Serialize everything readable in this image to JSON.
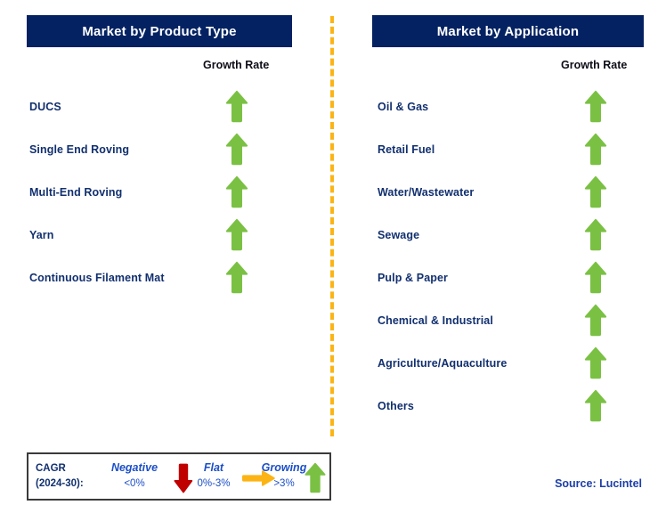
{
  "accent_colors": {
    "header_navy": "#042262",
    "label_navy": "#12306f",
    "arrow_green": "#7ac143",
    "arrow_red": "#c00000",
    "arrow_orange": "#fcb415",
    "divider_orange": "#fcb415",
    "legend_blue": "#1c4fc7",
    "source_blue": "#1c3fa8"
  },
  "left_panel": {
    "title": "Market by Product Type",
    "growth_rate_label": "Growth Rate",
    "rows": [
      {
        "label": "DUCS",
        "indicator": "up-arrow-icon",
        "growth": "Growing"
      },
      {
        "label": "Single End Roving",
        "indicator": "up-arrow-icon",
        "growth": "Growing"
      },
      {
        "label": "Multi-End Roving",
        "indicator": "up-arrow-icon",
        "growth": "Growing"
      },
      {
        "label": "Yarn",
        "indicator": "up-arrow-icon",
        "growth": "Growing"
      },
      {
        "label": "Continuous Filament Mat",
        "indicator": "up-arrow-icon",
        "growth": "Growing"
      }
    ]
  },
  "right_panel": {
    "title": "Market by Application",
    "growth_rate_label": "Growth Rate",
    "rows": [
      {
        "label": "Oil & Gas",
        "indicator": "up-arrow-icon",
        "growth": "Growing"
      },
      {
        "label": "Retail Fuel",
        "indicator": "up-arrow-icon",
        "growth": "Growing"
      },
      {
        "label": "Water/Wastewater",
        "indicator": "up-arrow-icon",
        "growth": "Growing"
      },
      {
        "label": "Sewage",
        "indicator": "up-arrow-icon",
        "growth": "Growing"
      },
      {
        "label": "Pulp & Paper",
        "indicator": "up-arrow-icon",
        "growth": "Growing"
      },
      {
        "label": "Chemical & Industrial",
        "indicator": "up-arrow-icon",
        "growth": "Growing"
      },
      {
        "label": "Agriculture/Aquaculture",
        "indicator": "up-arrow-icon",
        "growth": "Growing"
      },
      {
        "label": "Others",
        "indicator": "up-arrow-icon",
        "growth": "Growing"
      }
    ]
  },
  "legend": {
    "cagr_line1": "CAGR",
    "cagr_line2": "(2024-30):",
    "entries": [
      {
        "title": "Negative",
        "range": "<0%",
        "icon": "down-arrow-icon"
      },
      {
        "title": "Flat",
        "range": "0%-3%",
        "icon": "right-arrow-icon"
      },
      {
        "title": "Growing",
        "range": ">3%",
        "icon": "up-arrow-icon"
      }
    ]
  },
  "source": "Source: Lucintel"
}
